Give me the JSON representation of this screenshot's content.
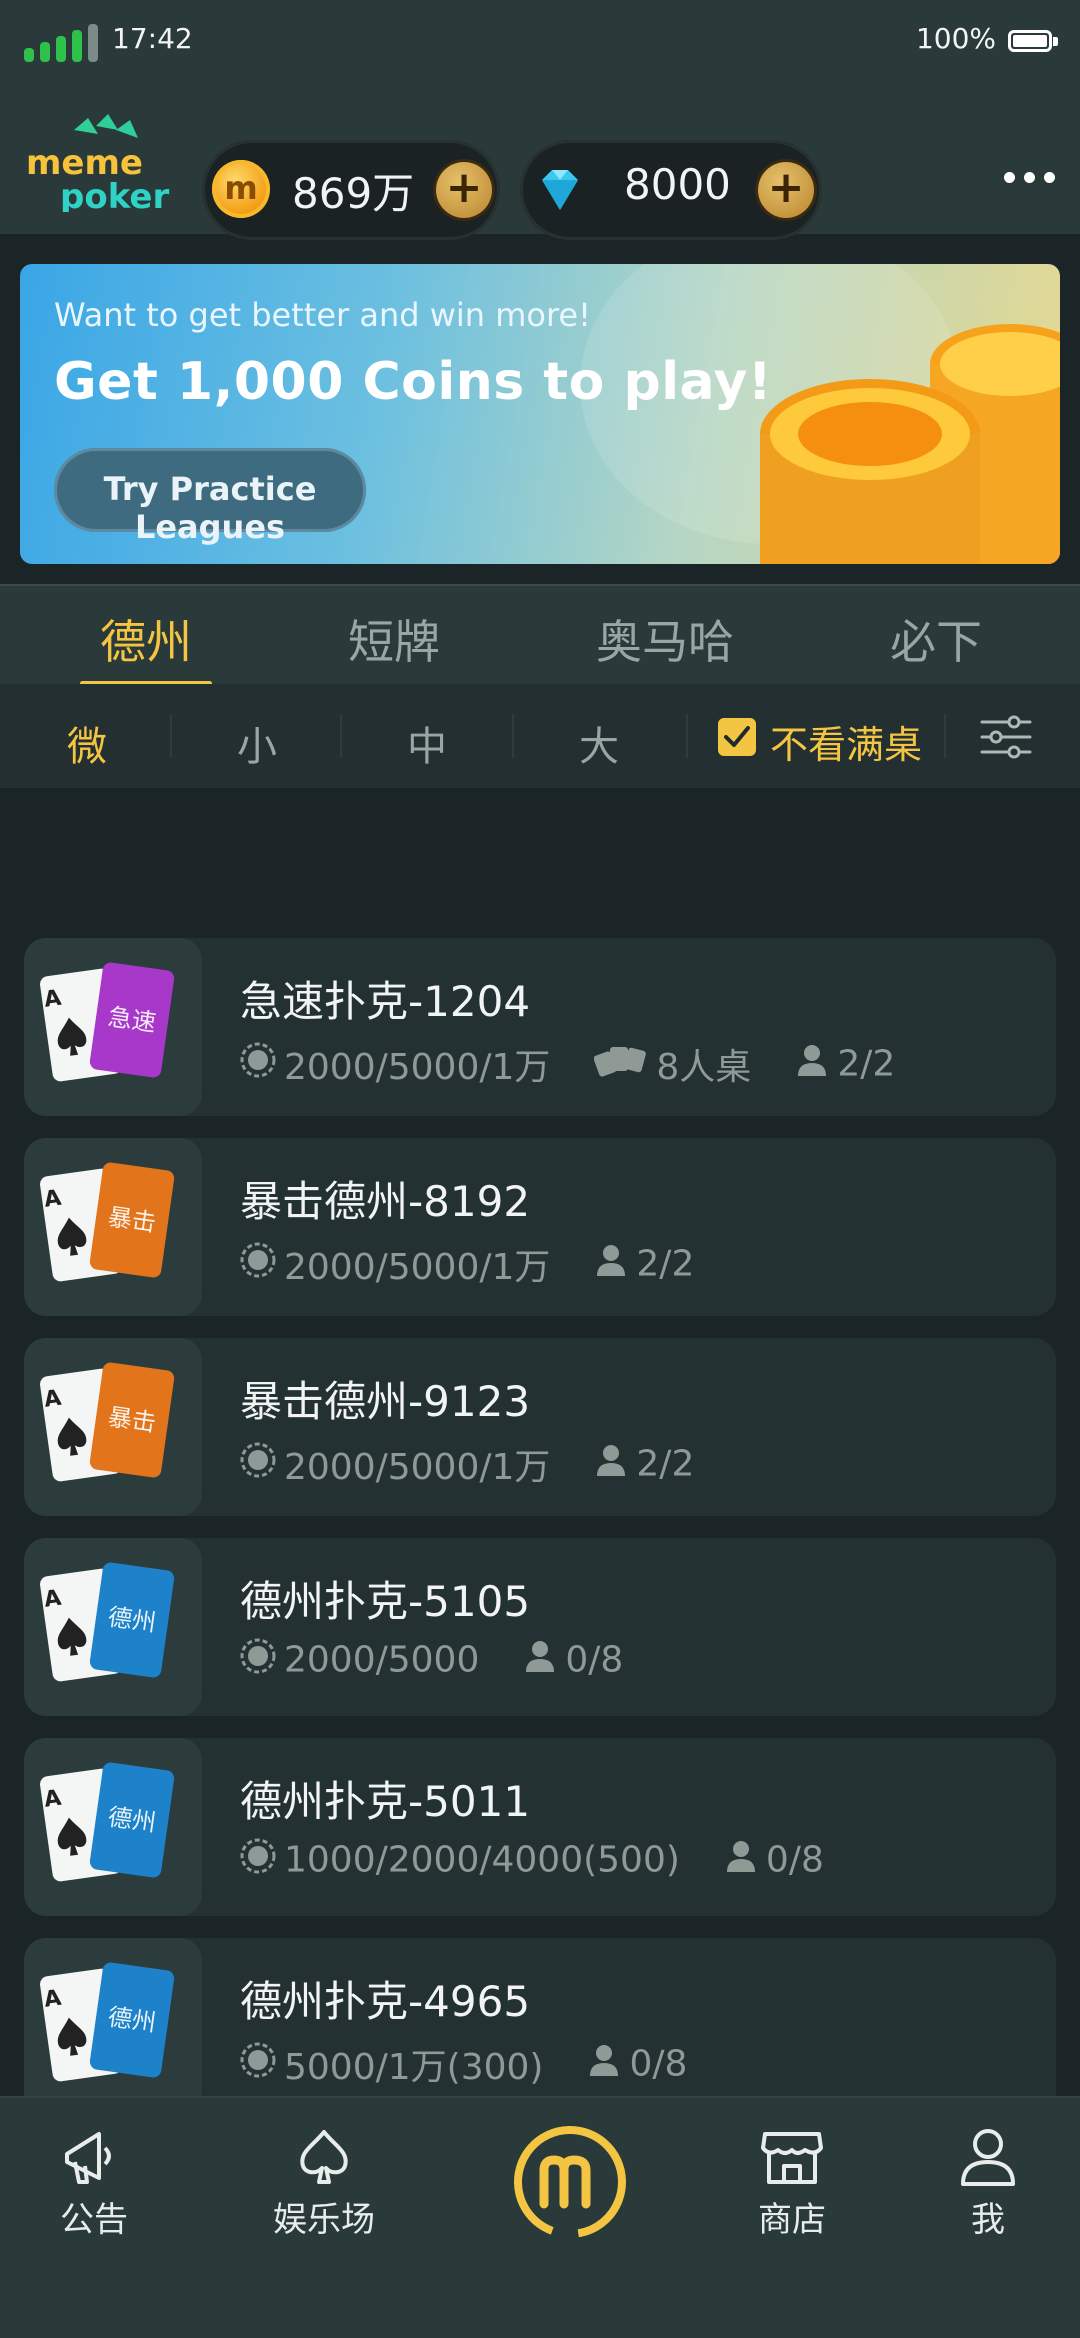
{
  "status": {
    "time": "17:42",
    "battery": "100%"
  },
  "header": {
    "logo": "meme poker",
    "coins": "869万",
    "gems": "8000"
  },
  "banner": {
    "subtitle": "Want to get better and win more!",
    "headline": "Get 1,000 Coins to play!",
    "cta": "Try Practice Leagues"
  },
  "game_tabs": [
    "德州",
    "短牌",
    "奥马哈",
    "必下"
  ],
  "active_game_tab": 0,
  "stakes": [
    "微",
    "小",
    "中",
    "大"
  ],
  "active_stake": 0,
  "hide_full": {
    "label": "不看满桌",
    "checked": true
  },
  "rooms": [
    {
      "name": "急速扑克-1204",
      "card": "急速",
      "blinds": "2000/5000/1万",
      "table": "8人桌",
      "players": "2/2",
      "color": "#a838c9"
    },
    {
      "name": "暴击德州-8192",
      "card": "暴击",
      "blinds": "2000/5000/1万",
      "players": "2/2",
      "color": "#e2741b"
    },
    {
      "name": "暴击德州-9123",
      "card": "暴击",
      "blinds": "2000/5000/1万",
      "players": "2/2",
      "color": "#e2741b"
    },
    {
      "name": "德州扑克-5105",
      "card": "德州",
      "blinds": "2000/5000",
      "players": "0/8",
      "color": "#1d82c9"
    },
    {
      "name": "德州扑克-5011",
      "card": "德州",
      "blinds": "1000/2000/4000(500)",
      "players": "0/8",
      "color": "#1d82c9"
    },
    {
      "name": "德州扑克-4965",
      "card": "德州",
      "blinds": "5000/1万(300)",
      "players": "0/8",
      "color": "#1d82c9"
    }
  ],
  "nav": {
    "announce": "公告",
    "entertainment": "娱乐场",
    "shop": "商店",
    "me": "我"
  },
  "colors": {
    "accent": "#f4c542",
    "background": "#1b2426",
    "bar": "#2a3a3a"
  }
}
